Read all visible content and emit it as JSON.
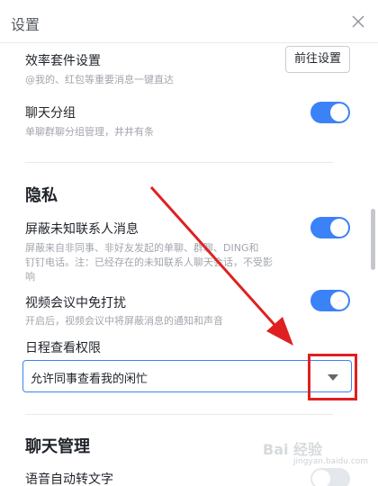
{
  "window": {
    "title": "设置"
  },
  "efficiency": {
    "title": "效率套件设置",
    "desc": "@我的、红包等重要消息一键直达",
    "button": "前往设置"
  },
  "chat_group": {
    "title": "聊天分组",
    "desc": "单聊群聊分组管理，井井有条",
    "enabled": true
  },
  "privacy": {
    "heading": "隐私",
    "block_unknown": {
      "title": "屏蔽未知联系人消息",
      "desc_line1": "屏蔽来自非同事、非好友发起的单聊、群聊、DING和",
      "desc_line2": "钉钉电话。注：已经存在的未知联系人聊天会话，不受影",
      "desc_line3": "响",
      "enabled": true
    },
    "meeting_dnd": {
      "title": "视频会议中免打扰",
      "desc": "开启后，视频会议中将屏蔽消息的通知和声音",
      "enabled": true
    },
    "schedule": {
      "label": "日程查看权限",
      "selected": "允许同事查看我的闲忙"
    }
  },
  "chat_mgmt": {
    "heading": "聊天管理",
    "voice_to_text": {
      "title": "语音自动转文字",
      "enabled": false
    }
  },
  "watermark": {
    "brand": "Bai 经验",
    "url": "jingyan.baidu.com"
  },
  "annotation": {
    "color": "#e02020"
  },
  "colors": {
    "accent": "#3b82f6",
    "toggle_off": "#e4e7ec"
  }
}
